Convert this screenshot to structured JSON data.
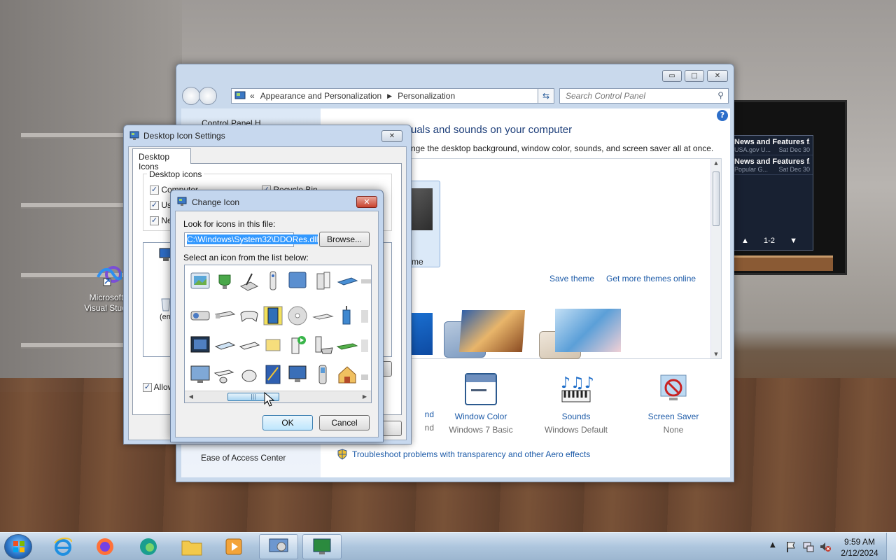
{
  "desktop": {
    "icons": [
      {
        "label": "Microsoft Visual Studio",
        "label_line1": "Microsoft",
        "label_line2": "Visual Studi"
      }
    ],
    "gadget": {
      "items": [
        {
          "title": "News and Features f...",
          "source": "USA.gov U...",
          "date": "Sat Dec 30"
        },
        {
          "title": "News and Features f...",
          "source": "Popular G...",
          "date": "Sat Dec 30"
        }
      ],
      "pager": "1-2"
    }
  },
  "control_panel": {
    "breadcrumb": [
      "Appearance and Personalization",
      "Personalization"
    ],
    "breadcrumb_prefix": "«",
    "search_placeholder": "Search Control Panel",
    "left_nav_top": "Control Panel H",
    "heading": "uals and sounds on your computer",
    "subheading": "nge the desktop background, window color, sounds, and screen saver all at once.",
    "theme_label_fragment": "me",
    "save_theme": "Save theme",
    "get_more_themes": "Get more themes online",
    "bottom_items": [
      {
        "label": "nd",
        "value": "nd",
        "icon": "desktop-background-icon"
      },
      {
        "label": "Window Color",
        "value": "Windows 7 Basic",
        "icon": "window-color-icon"
      },
      {
        "label": "Sounds",
        "value": "Windows Default",
        "icon": "sounds-icon"
      },
      {
        "label": "Screen Saver",
        "value": "None",
        "icon": "screen-saver-icon"
      }
    ],
    "see_also": "Ease of Access Center",
    "troubleshoot": "Troubleshoot problems with transparency and other Aero effects"
  },
  "desktop_icon_settings": {
    "title": "Desktop Icon Settings",
    "tab": "Desktop Icons",
    "group_label": "Desktop icons",
    "checkboxes": [
      {
        "label": "Computer",
        "checked": true
      },
      {
        "label": "Recycle Bin",
        "checked": true
      },
      {
        "label": "Use",
        "checked": true
      },
      {
        "label": "Ne",
        "checked": true
      }
    ],
    "empty_label": "(em",
    "allow_label": "Allow",
    "button_fragment": "t"
  },
  "change_icon": {
    "title": "Change Icon",
    "look_label": "Look for icons in this file:",
    "path": "C:\\Windows\\System32\\DDORes.dll",
    "browse": "Browse...",
    "select_label": "Select an icon from the list below:",
    "ok": "OK",
    "cancel": "Cancel"
  },
  "taskbar": {
    "time": "9:59 AM",
    "date": "2/12/2024",
    "pinned": [
      "start-orb",
      "internet-explorer",
      "firefox",
      "edge",
      "file-explorer",
      "media-player",
      "control-panel",
      "personalization"
    ]
  },
  "colors": {
    "accent": "#1d5ba8",
    "selection": "#3399ff",
    "close_red": "#c9432e"
  }
}
